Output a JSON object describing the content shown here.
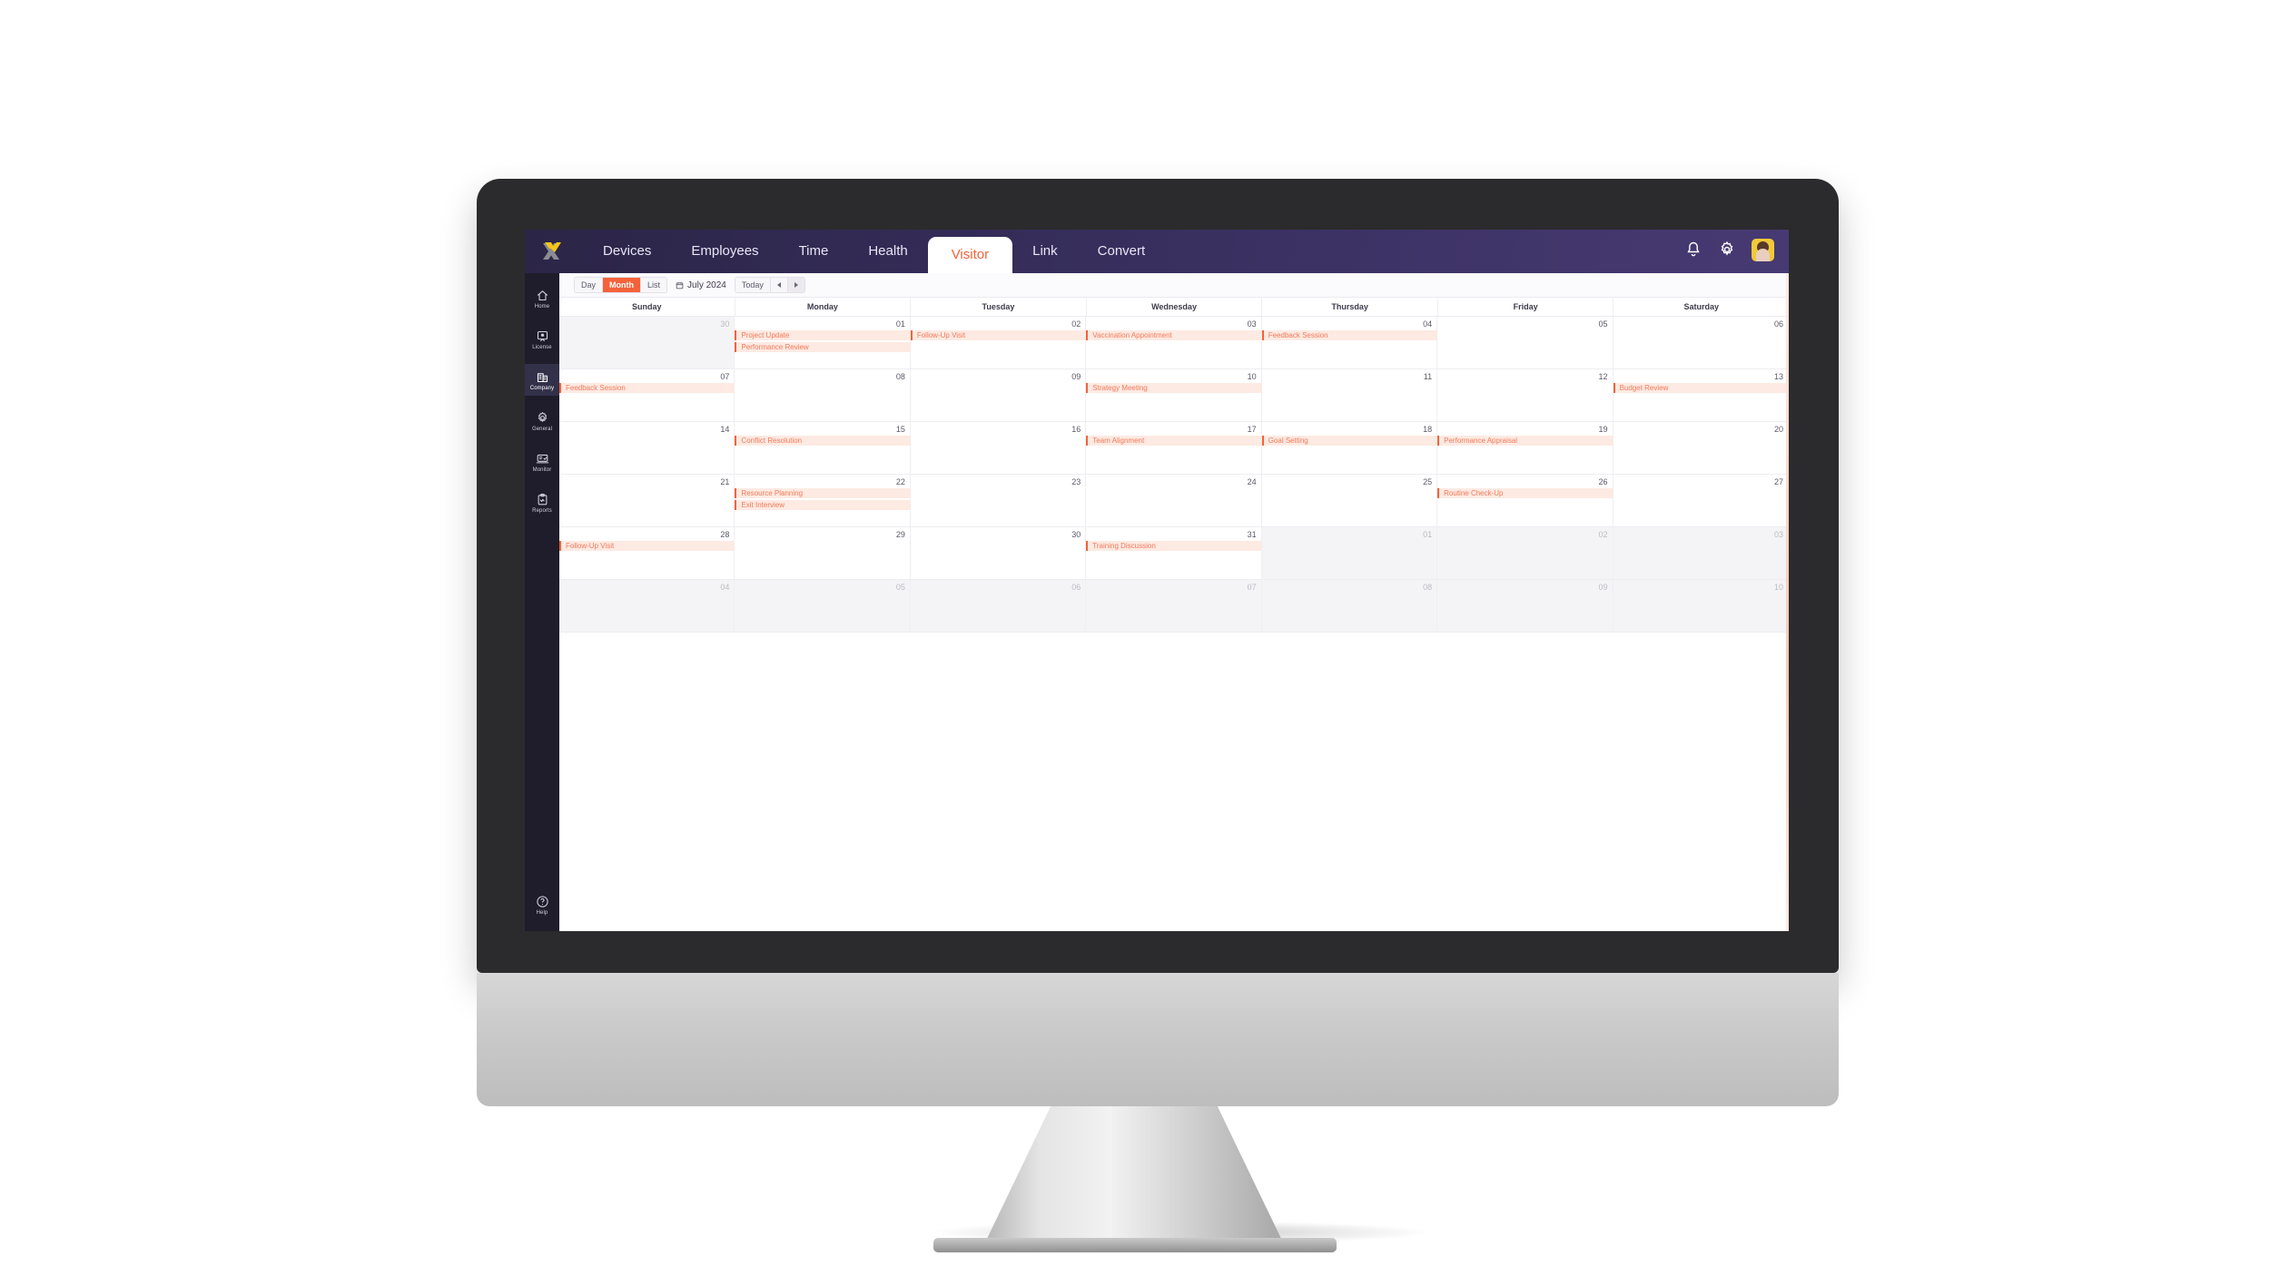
{
  "topbar": {
    "logo_name": "x-logo-icon",
    "tabs": [
      {
        "label": "Devices",
        "active": false
      },
      {
        "label": "Employees",
        "active": false
      },
      {
        "label": "Time",
        "active": false
      },
      {
        "label": "Health",
        "active": false
      },
      {
        "label": "Visitor",
        "active": true
      },
      {
        "label": "Link",
        "active": false
      },
      {
        "label": "Convert",
        "active": false
      }
    ],
    "icons": {
      "notifications": "bell-icon",
      "settings": "gear-icon",
      "avatar": "user-avatar"
    }
  },
  "sidebar": {
    "items": [
      {
        "label": "Home",
        "icon": "home-icon",
        "active": false
      },
      {
        "label": "License",
        "icon": "license-badge-icon",
        "active": false
      },
      {
        "label": "Company",
        "icon": "building-icon",
        "active": true
      },
      {
        "label": "General",
        "icon": "gear-icon",
        "active": false
      },
      {
        "label": "Monitor",
        "icon": "monitor-icon",
        "active": false
      },
      {
        "label": "Reports",
        "icon": "clipboard-report-icon",
        "active": false
      }
    ],
    "help": {
      "label": "Help",
      "icon": "question-circle-icon"
    }
  },
  "calendar": {
    "view_buttons": [
      {
        "label": "Day",
        "active": false
      },
      {
        "label": "Month",
        "active": true
      },
      {
        "label": "List",
        "active": false
      }
    ],
    "title": "July 2024",
    "title_icon": "calendar-icon",
    "today_label": "Today",
    "prev_label": "prev-arrow-icon",
    "next_label": "next-arrow-icon",
    "day_headers": [
      "Sunday",
      "Monday",
      "Tuesday",
      "Wednesday",
      "Thursday",
      "Friday",
      "Saturday"
    ],
    "colors": {
      "accent": "#f4623a",
      "event_bg": "#fdeae2",
      "event_text": "#f4795a",
      "topbar": "#372e5c",
      "sidebar": "#1f1d2b"
    },
    "weeks": [
      {
        "days": [
          {
            "num": "30",
            "other": true
          },
          {
            "num": "01",
            "other": false
          },
          {
            "num": "02",
            "other": false
          },
          {
            "num": "03",
            "other": false
          },
          {
            "num": "04",
            "other": false
          },
          {
            "num": "05",
            "other": false
          },
          {
            "num": "06",
            "other": false
          }
        ],
        "events": [
          {
            "title": "Project Update",
            "col": 1,
            "span": 1,
            "row": 0
          },
          {
            "title": "Performance Review",
            "col": 1,
            "span": 1,
            "row": 1
          },
          {
            "title": "Follow-Up Visit",
            "col": 2,
            "span": 1,
            "row": 0
          },
          {
            "title": "Vaccination Appointment",
            "col": 3,
            "span": 1,
            "row": 0
          },
          {
            "title": "Feedback Session",
            "col": 4,
            "span": 1,
            "row": 0
          }
        ]
      },
      {
        "days": [
          {
            "num": "07",
            "other": false
          },
          {
            "num": "08",
            "other": false
          },
          {
            "num": "09",
            "other": false
          },
          {
            "num": "10",
            "other": false
          },
          {
            "num": "11",
            "other": false
          },
          {
            "num": "12",
            "other": false
          },
          {
            "num": "13",
            "other": false
          }
        ],
        "events": [
          {
            "title": "Feedback Session",
            "col": 0,
            "span": 1,
            "row": 0
          },
          {
            "title": "Strategy Meeting",
            "col": 3,
            "span": 1,
            "row": 0
          },
          {
            "title": "Budget Review",
            "col": 6,
            "span": 1,
            "row": 0
          }
        ]
      },
      {
        "days": [
          {
            "num": "14",
            "other": false
          },
          {
            "num": "15",
            "other": false
          },
          {
            "num": "16",
            "other": false
          },
          {
            "num": "17",
            "other": false
          },
          {
            "num": "18",
            "other": false
          },
          {
            "num": "19",
            "other": false
          },
          {
            "num": "20",
            "other": false
          }
        ],
        "events": [
          {
            "title": "Conflict Resolution",
            "col": 1,
            "span": 1,
            "row": 0
          },
          {
            "title": "Team Alignment",
            "col": 3,
            "span": 1,
            "row": 0
          },
          {
            "title": "Goal Setting",
            "col": 4,
            "span": 1,
            "row": 0
          },
          {
            "title": "Performance Appraisal",
            "col": 5,
            "span": 1,
            "row": 0
          }
        ]
      },
      {
        "days": [
          {
            "num": "21",
            "other": false
          },
          {
            "num": "22",
            "other": false
          },
          {
            "num": "23",
            "other": false
          },
          {
            "num": "24",
            "other": false
          },
          {
            "num": "25",
            "other": false
          },
          {
            "num": "26",
            "other": false
          },
          {
            "num": "27",
            "other": false
          }
        ],
        "events": [
          {
            "title": "Resource Planning",
            "col": 1,
            "span": 1,
            "row": 0
          },
          {
            "title": "Exit Interview",
            "col": 1,
            "span": 1,
            "row": 1
          },
          {
            "title": "Routine Check-Up",
            "col": 5,
            "span": 1,
            "row": 0
          }
        ]
      },
      {
        "days": [
          {
            "num": "28",
            "other": false
          },
          {
            "num": "29",
            "other": false
          },
          {
            "num": "30",
            "other": false
          },
          {
            "num": "31",
            "other": false
          },
          {
            "num": "01",
            "other": true
          },
          {
            "num": "02",
            "other": true
          },
          {
            "num": "03",
            "other": true
          }
        ],
        "events": [
          {
            "title": "Follow-Up Visit",
            "col": 0,
            "span": 1,
            "row": 0
          },
          {
            "title": "Training Discussion",
            "col": 3,
            "span": 1,
            "row": 0
          }
        ]
      },
      {
        "days": [
          {
            "num": "04",
            "other": true
          },
          {
            "num": "05",
            "other": true
          },
          {
            "num": "06",
            "other": true
          },
          {
            "num": "07",
            "other": true
          },
          {
            "num": "08",
            "other": true
          },
          {
            "num": "09",
            "other": true
          },
          {
            "num": "10",
            "other": true
          }
        ],
        "events": []
      }
    ]
  }
}
